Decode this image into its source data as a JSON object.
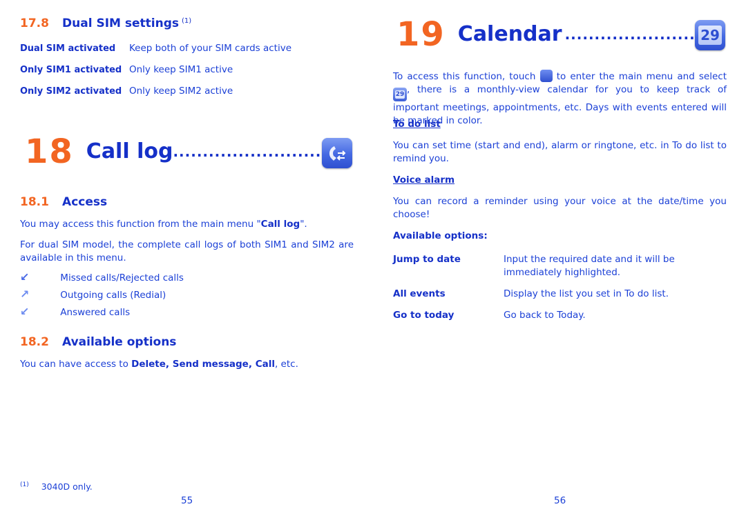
{
  "left_page": {
    "section_17_8": {
      "number": "17.8",
      "title": "Dual SIM settings",
      "footnote_ref": "(1)",
      "options": [
        {
          "term": "Dual SIM activated",
          "desc": "Keep both of your SIM cards active"
        },
        {
          "term": "Only SIM1 activated",
          "desc": "Only keep SIM1 active"
        },
        {
          "term": "Only SIM2 activated",
          "desc": "Only keep SIM2 active"
        }
      ]
    },
    "chapter": {
      "number": "18",
      "title": "Call log",
      "dots": "...........................",
      "icon": "call-log-icon"
    },
    "section_18_1": {
      "number": "18.1",
      "title": "Access",
      "para1_before": "You may access this function from the main menu \"",
      "para1_bold": "Call log",
      "para1_after": "\".",
      "para2": "For dual SIM model, the complete call logs of both SIM1 and SIM2 are available in this menu.",
      "call_types": [
        {
          "icon": "missed-call-arrow-icon",
          "glyph": "↙",
          "label": "Missed calls/Rejected calls"
        },
        {
          "icon": "outgoing-call-arrow-icon",
          "glyph": "↗",
          "label": "Outgoing calls (Redial)"
        },
        {
          "icon": "answered-call-arrow-icon",
          "glyph": "↙",
          "label": "Answered calls"
        }
      ]
    },
    "section_18_2": {
      "number": "18.2",
      "title": "Available options",
      "text_before": "You can have access to ",
      "bold1": "Delete",
      "sep1": ", ",
      "bold2": "Send message",
      "sep2": ", ",
      "bold3": "Call",
      "text_after": ", etc."
    },
    "footnote": {
      "marker": "(1)",
      "text": "3040D only."
    },
    "page_number": "55"
  },
  "right_page": {
    "chapter": {
      "number": "19",
      "title": "Calendar",
      "dots": "........................",
      "icon": "calendar-icon",
      "icon_text": "29"
    },
    "intro": {
      "part1": "To access this function, touch",
      "part2": "to enter the main menu and select",
      "part3": ", there is a monthly-view calendar for you to keep track of important meetings, appointments, etc. Days with events entered will be marked in color.",
      "menu_icon": "main-menu-grid-icon",
      "calendar_icon_text": "29"
    },
    "todo": {
      "heading": "To do list",
      "text": "You can set time (start and end), alarm or ringtone, etc. in To do list to remind you."
    },
    "voice_alarm": {
      "heading": "Voice alarm",
      "text": "You can record a reminder using your voice at the date/time you choose!"
    },
    "available_options": {
      "heading": "Available options:",
      "options": [
        {
          "term": "Jump to date",
          "desc": "Input the required date and it will be immediately highlighted."
        },
        {
          "term": "All events",
          "desc": "Display the list you set in To do list."
        },
        {
          "term": "Go to today",
          "desc": "Go back to Today."
        }
      ]
    },
    "page_number": "56"
  },
  "colors": {
    "text_blue": "#1a3fd6",
    "heading_blue": "#1530c8",
    "accent_orange": "#f26522"
  }
}
